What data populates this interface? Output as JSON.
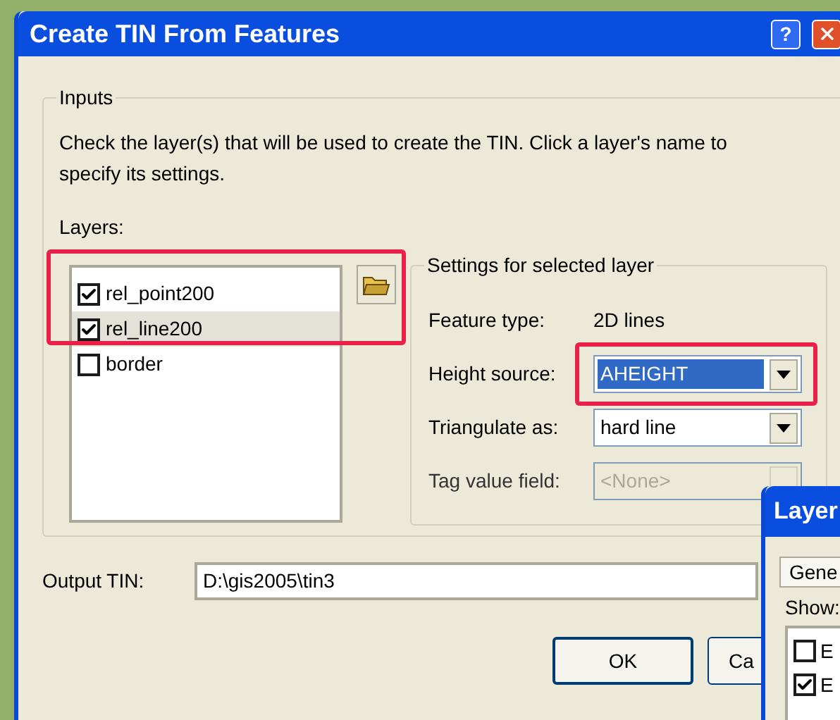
{
  "window": {
    "title": "Create TIN From Features",
    "help_button": "?"
  },
  "inputs": {
    "title": "Inputs",
    "instructions": "Check the layer(s) that will be used to create the TIN.  Click a layer's name to specify its settings.",
    "layers_label": "Layers:",
    "layers": [
      {
        "name": "rel_point200",
        "checked": true,
        "selected": false
      },
      {
        "name": "rel_line200",
        "checked": true,
        "selected": true
      },
      {
        "name": "border",
        "checked": false,
        "selected": false
      }
    ]
  },
  "settings": {
    "title": "Settings for selected layer",
    "feature_type_label": "Feature type:",
    "feature_type": "2D lines",
    "fields": [
      {
        "label": "Height source:",
        "value": "AHEIGHT",
        "focused": true,
        "disabled": false
      },
      {
        "label": "Triangulate as:",
        "value": "hard line",
        "focused": false,
        "disabled": false
      },
      {
        "label": "Tag value field:",
        "value": "<None>",
        "focused": false,
        "disabled": true
      }
    ]
  },
  "output": {
    "label": "Output TIN:",
    "value": "D:\\gis2005\\tin3"
  },
  "buttons": [
    "OK",
    "Ca"
  ],
  "layer_window": {
    "title": "Layer",
    "tab": "Gene",
    "show_label": "Show:",
    "items": [
      {
        "label": "E",
        "checked": false
      },
      {
        "label": "E",
        "checked": true
      }
    ]
  }
}
